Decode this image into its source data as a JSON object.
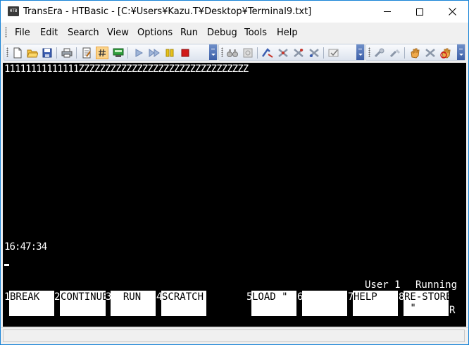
{
  "window": {
    "app_icon_text": "HTB",
    "title": "TransEra - HTBasic - [C:¥Users¥Kazu.T¥Desktop¥Terminal9.txt]"
  },
  "menu": [
    "File",
    "Edit",
    "Search",
    "View",
    "Options",
    "Run",
    "Debug",
    "Tools",
    "Help"
  ],
  "toolbar": {
    "icons": [
      "new-file",
      "open-folder",
      "save",
      "print",
      "edit-program",
      "line-number",
      "calculator",
      "run-play",
      "continue",
      "pause",
      "stop",
      "find",
      "replace",
      "breakpoint",
      "step-into",
      "step-over",
      "step-out",
      "watch",
      "options-wrench",
      "tools",
      "hand",
      "stop-hand"
    ]
  },
  "terminal": {
    "line1": "11111111111111ZZZZZZZZZZZZZZZZZZZZZZZZZZZZZZZZ",
    "clock": "16:47:34",
    "status_user": "User 1",
    "status_state": "Running",
    "extra_char": "R"
  },
  "softkeys": [
    {
      "num": "1",
      "label": "BREAK"
    },
    {
      "num": "2",
      "label": "CONTINUE"
    },
    {
      "num": "3",
      "label": "  RUN"
    },
    {
      "num": "4",
      "label": "SCRATCH"
    },
    {
      "num": "5",
      "label": "LOAD \""
    },
    {
      "num": "6",
      "label": ""
    },
    {
      "num": "7",
      "label": "HELP"
    },
    {
      "num": "8",
      "label": "RE-STORE\n \""
    }
  ],
  "colors": {
    "terminal_bg": "#000000",
    "terminal_fg": "#ffffff",
    "softkey_bg": "#ffffff",
    "window_border": "#1883d7",
    "toolbar_active": "#fbd38a"
  }
}
